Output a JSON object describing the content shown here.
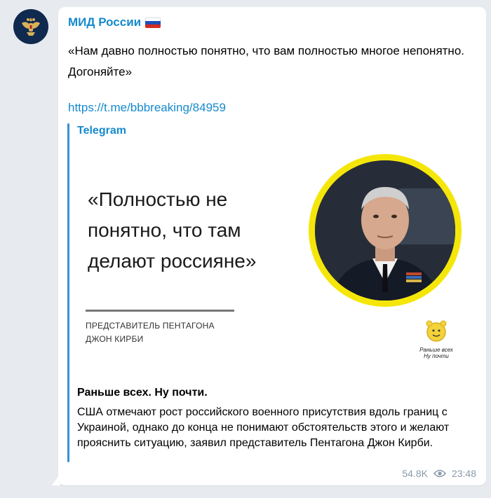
{
  "channel": {
    "name": "МИД России",
    "flag_colors": [
      "#ffffff",
      "#1f4fb8",
      "#d52b1e"
    ]
  },
  "message": {
    "text": "«Нам давно полностью понятно, что вам полностью многое непонятно. Догоняйте»",
    "link": "https://t.me/bbbreaking/84959"
  },
  "preview": {
    "site_name": "Telegram",
    "image": {
      "quote": "«Полностью не понятно, что там делают россияне»",
      "caption_line1": "Представитель Пентагона",
      "caption_line2": "Джон Кирби",
      "logo_text_line1": "Раньше всех",
      "logo_text_line2": "Ну почти"
    },
    "title": "Раньше всех. Ну почти.",
    "description": "США отмечают рост российского военного присутствия вдоль границ с Украиной, однако до конца не понимают обстоятельств этого и желают прояснить ситуацию, заявил представитель Пентагона Джон Кирби."
  },
  "meta": {
    "views": "54.8K",
    "time": "23:48",
    "view_icon": "eye-icon"
  },
  "colors": {
    "accent": "#168acd",
    "bubble": "#ffffff",
    "background": "#e7ebf0",
    "photo_ring": "#f5e60a"
  }
}
